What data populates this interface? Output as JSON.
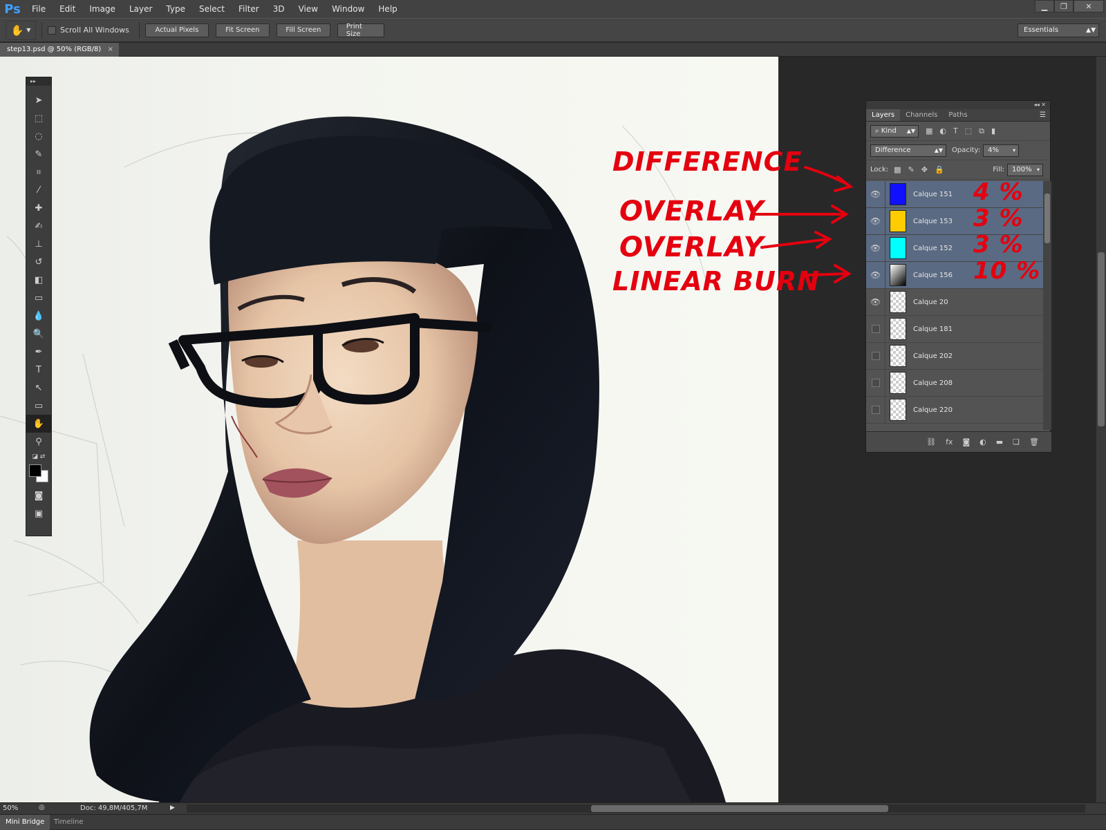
{
  "app": {
    "logo": "Ps"
  },
  "menu": [
    "File",
    "Edit",
    "Image",
    "Layer",
    "Type",
    "Select",
    "Filter",
    "3D",
    "View",
    "Window",
    "Help"
  ],
  "options_bar": {
    "scroll_all_windows": "Scroll All Windows",
    "buttons": [
      "Actual Pixels",
      "Fit Screen",
      "Fill Screen",
      "Print Size"
    ],
    "workspace": "Essentials"
  },
  "document_tab": "step13.psd @ 50% (RGB/8)",
  "status": {
    "zoom": "50%",
    "doc_info": "Doc: 49,8M/405,7M"
  },
  "bottom_tabs": [
    "Mini Bridge",
    "Timeline"
  ],
  "layers_panel": {
    "tabs": [
      "Layers",
      "Channels",
      "Paths"
    ],
    "filter_kind": "Kind",
    "blend_mode": "Difference",
    "opacity_label": "Opacity:",
    "opacity_value": "4%",
    "lock_label": "Lock:",
    "fill_label": "Fill:",
    "fill_value": "100%",
    "layers": [
      {
        "name": "Calque 151",
        "visible": true,
        "selected": true,
        "swatch": "#1010ff"
      },
      {
        "name": "Calque 153",
        "visible": true,
        "selected": true,
        "swatch": "#ffcc00"
      },
      {
        "name": "Calque 152",
        "visible": true,
        "selected": true,
        "swatch": "#00ffff"
      },
      {
        "name": "Calque 156",
        "visible": true,
        "selected": true,
        "swatch": "gradient"
      },
      {
        "name": "Calque 20",
        "visible": true,
        "selected": false,
        "swatch": "transparent"
      },
      {
        "name": "Calque 181",
        "visible": false,
        "selected": false,
        "swatch": "transparent"
      },
      {
        "name": "Calque 202",
        "visible": false,
        "selected": false,
        "swatch": "transparent"
      },
      {
        "name": "Calque 208",
        "visible": false,
        "selected": false,
        "swatch": "transparent"
      },
      {
        "name": "Calque 220",
        "visible": false,
        "selected": false,
        "swatch": "transparent"
      }
    ]
  },
  "annotations": {
    "modes": [
      "DIFFERENCE",
      "OVERLAY",
      "OVERLAY",
      "LINEAR BURN"
    ],
    "percents": [
      "4 %",
      "3 %",
      "3 %",
      "10 %"
    ],
    "color": "#e4000f"
  }
}
